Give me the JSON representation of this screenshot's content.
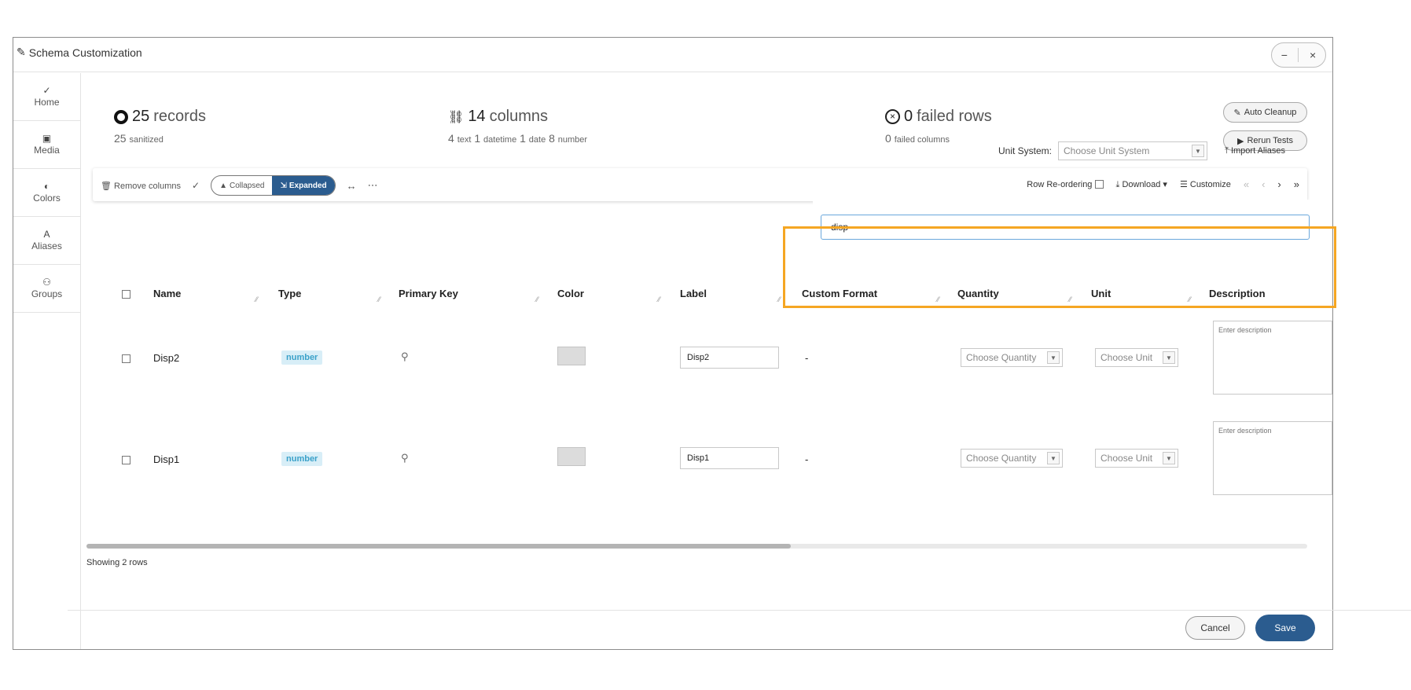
{
  "window": {
    "title": "Schema Customization",
    "minimize_label": "−",
    "close_label": "×"
  },
  "sidebar": {
    "items": [
      {
        "icon": "✓",
        "label": "Home"
      },
      {
        "icon": "▣",
        "label": "Media"
      },
      {
        "icon": "◐",
        "label": "Colors"
      },
      {
        "icon": "A",
        "label": "Aliases"
      },
      {
        "icon": "⚇",
        "label": "Groups"
      }
    ]
  },
  "stats": {
    "records": {
      "count": "25",
      "label": "records",
      "sub_count": "25",
      "sub_label": "sanitized"
    },
    "columns": {
      "count": "14",
      "label": "columns",
      "text_count": "4",
      "text_label": "text",
      "datetime_count": "1",
      "datetime_label": "datetime",
      "date_count": "1",
      "date_label": "date",
      "number_count": "8",
      "number_label": "number"
    },
    "failed": {
      "count": "0",
      "label": "failed rows",
      "sub_count": "0",
      "sub_label": "failed columns"
    }
  },
  "actions": {
    "auto_cleanup": "Auto Cleanup",
    "rerun_tests": "Rerun Tests",
    "unit_system_label": "Unit System:",
    "unit_system_placeholder": "Choose Unit System",
    "import_aliases": "Import Aliases"
  },
  "toolbar": {
    "remove_columns": "Remove columns",
    "collapsed": "Collapsed",
    "expanded": "Expanded",
    "row_reordering": "Row Re-ordering",
    "download": "Download ▾",
    "customize": "Customize"
  },
  "search": {
    "value": "disp"
  },
  "columns": [
    "Name",
    "Type",
    "Primary Key",
    "Color",
    "Label",
    "Custom Format",
    "Quantity",
    "Unit",
    "Description"
  ],
  "rows": [
    {
      "name": "Disp2",
      "type": "number",
      "label": "Disp2",
      "custom_format": "-",
      "quantity_placeholder": "Choose Quantity",
      "unit_placeholder": "Choose Unit",
      "description_placeholder": "Enter description"
    },
    {
      "name": "Disp1",
      "type": "number",
      "label": "Disp1",
      "custom_format": "-",
      "quantity_placeholder": "Choose Quantity",
      "unit_placeholder": "Choose Unit",
      "description_placeholder": "Enter description"
    }
  ],
  "footer": {
    "showing": "Showing 2 rows",
    "cancel": "Cancel",
    "save": "Save"
  },
  "colors": {
    "primary": "#2b5c8f",
    "highlight": "#f5a623",
    "badge_bg": "#d8eef7",
    "badge_text": "#3aa1c9"
  }
}
